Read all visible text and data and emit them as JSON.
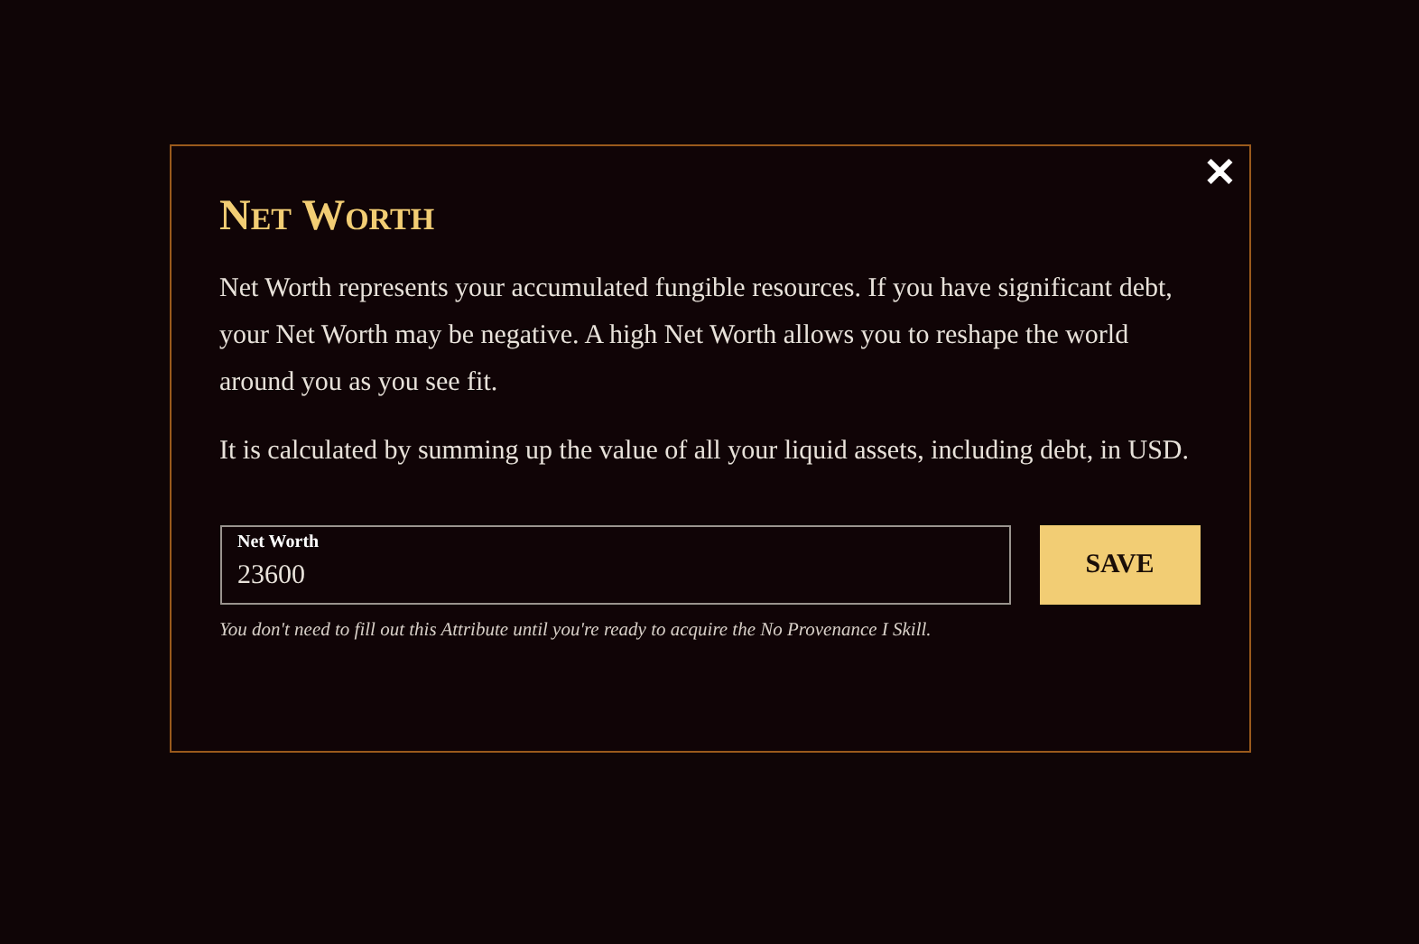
{
  "dialog": {
    "title": "Net Worth",
    "close": "✕",
    "paragraphs": [
      "Net Worth represents your accumulated fungible resources. If you have significant debt, your Net Worth may be negative. A high Net Worth allows you to reshape the world around you as you see fit.",
      "It is calculated by summing up the value of all your liquid assets, including debt, in USD."
    ],
    "field": {
      "label": "Net Worth",
      "value": "23600"
    },
    "save_button": "SAVE",
    "hint": "You don't need to fill out this Attribute until you're ready to acquire the No Provenance I Skill."
  }
}
